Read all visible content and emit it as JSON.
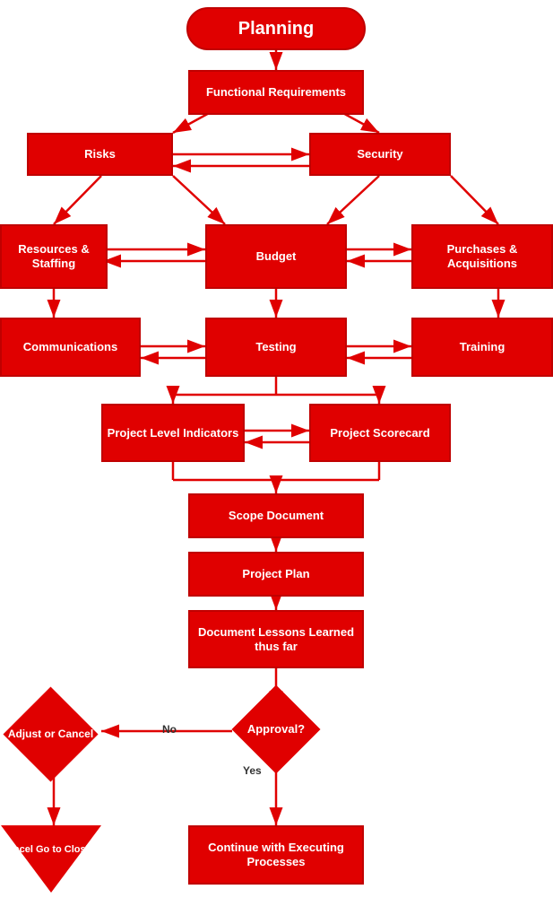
{
  "diagram": {
    "title": "Planning",
    "nodes": {
      "planning": {
        "label": "Planning"
      },
      "functional_requirements": {
        "label": "Functional Requirements"
      },
      "risks": {
        "label": "Risks"
      },
      "security": {
        "label": "Security"
      },
      "resources_staffing": {
        "label": "Resources & Staffing"
      },
      "budget": {
        "label": "Budget"
      },
      "purchases_acquisitions": {
        "label": "Purchases & Acquisitions"
      },
      "communications": {
        "label": "Communications"
      },
      "testing": {
        "label": "Testing"
      },
      "training": {
        "label": "Training"
      },
      "project_level_indicators": {
        "label": "Project Level Indicators"
      },
      "project_scorecard": {
        "label": "Project Scorecard"
      },
      "scope_document": {
        "label": "Scope Document"
      },
      "project_plan": {
        "label": "Project Plan"
      },
      "document_lessons": {
        "label": "Document Lessons Learned thus far"
      },
      "approval": {
        "label": "Approval?"
      },
      "adjust_cancel": {
        "label": "Adjust or Cancel"
      },
      "cancel_closing": {
        "label": "Cancel Go to Closing"
      },
      "continue_executing": {
        "label": "Continue with Executing Processes"
      }
    },
    "labels": {
      "no": "No",
      "yes": "Yes"
    }
  }
}
